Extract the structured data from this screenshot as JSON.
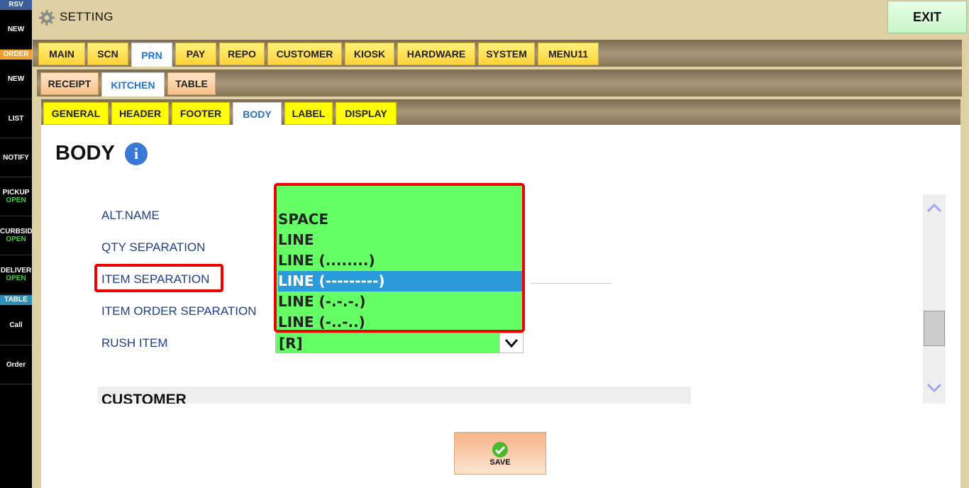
{
  "window": {
    "title": "SETTING",
    "exit_label": "EXIT"
  },
  "sidebar": {
    "rsv_header": "RSV",
    "rsv_new": "NEW",
    "order_header": "ORDER",
    "order_new": "NEW",
    "list": "LIST",
    "notify": "NOTIFY",
    "pickup": {
      "label": "PICKUP",
      "status": "OPEN"
    },
    "curbside": {
      "label": "CURBSID",
      "status": "OPEN"
    },
    "delivery": {
      "label": "DELIVER",
      "status": "OPEN"
    },
    "table_header": "TABLE",
    "call": "Call",
    "order": "Order",
    "colors": {
      "rsv": "#3b5f9a",
      "order": "#f0a030",
      "table": "#2f8fb8",
      "open": "#3bd23b"
    }
  },
  "tabs_main": [
    "MAIN",
    "SCN",
    "PRN",
    "PAY",
    "REPO",
    "CUSTOMER",
    "KIOSK",
    "HARDWARE",
    "SYSTEM",
    "MENU11"
  ],
  "tabs_main_active": "PRN",
  "tabs_prn": [
    "RECEIPT",
    "KITCHEN",
    "TABLE"
  ],
  "tabs_prn_active": "KITCHEN",
  "tabs_kitchen": [
    "GENERAL",
    "HEADER",
    "FOOTER",
    "BODY",
    "LABEL",
    "DISPLAY"
  ],
  "tabs_kitchen_active": "BODY",
  "section": {
    "title": "BODY",
    "info_icon": "i"
  },
  "fields": {
    "alt_name": "ALT.NAME",
    "qty_separation": "QTY SEPARATION",
    "item_separation": "ITEM SEPARATION",
    "item_order_separation": "ITEM ORDER SEPARATION",
    "rush_item": "RUSH ITEM"
  },
  "dropdown": {
    "options": [
      "",
      "SPACE",
      "LINE",
      "LINE (........)",
      "LINE (---------)",
      "LINE (-.-.-.)",
      "LINE (-..-..)"
    ],
    "selected": "LINE (---------)"
  },
  "rush_item": {
    "value": "[R]"
  },
  "customer_section": {
    "title": "CUSTOMER"
  },
  "save": {
    "label": "SAVE"
  },
  "colors": {
    "highlight": "#e00000",
    "dropdown_bg": "#66ff66",
    "selection": "#2a9bd8",
    "accent_blue": "#2872c2"
  }
}
